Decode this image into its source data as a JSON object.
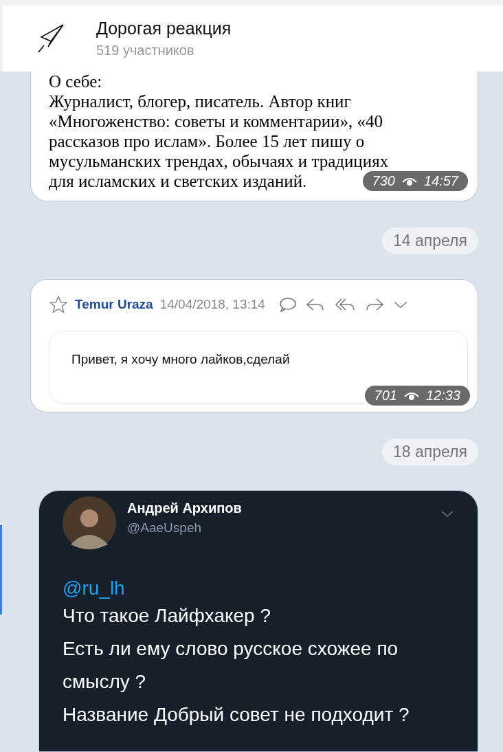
{
  "header": {
    "title": "Дорогая реакция",
    "subtitle": "519 участников"
  },
  "messages": [
    {
      "kind": "text",
      "heading": "О себе:",
      "lines": [
        "Журналист, блогер, писатель. Автор книг",
        "«Многоженство: советы и комментарии», «40",
        "рассказов про ислам». Более 15 лет пишу о",
        "мусульманских трендах, обычаях и традициях",
        "для исламских и светских изданий."
      ],
      "views": "730",
      "time": "14:57"
    },
    {
      "kind": "date",
      "label": "14 апреля"
    },
    {
      "kind": "email",
      "sender": "Temur Uraza",
      "date": "14/04/2018, 13:14",
      "starred": false,
      "body": "Привет, я хочу много лайков,сделай",
      "views": "701",
      "time": "12:33"
    },
    {
      "kind": "date",
      "label": "18 апреля"
    },
    {
      "kind": "tweet",
      "name": "Андрей Архипов",
      "handle": "@AaeUspeh",
      "mention": "@ru_lh",
      "lines": [
        "Что такое Лайфхакер ?",
        "Есть ли ему слово русское схожее по смыслу ?",
        "Название Добрый совет не подходит ?"
      ]
    }
  ]
}
